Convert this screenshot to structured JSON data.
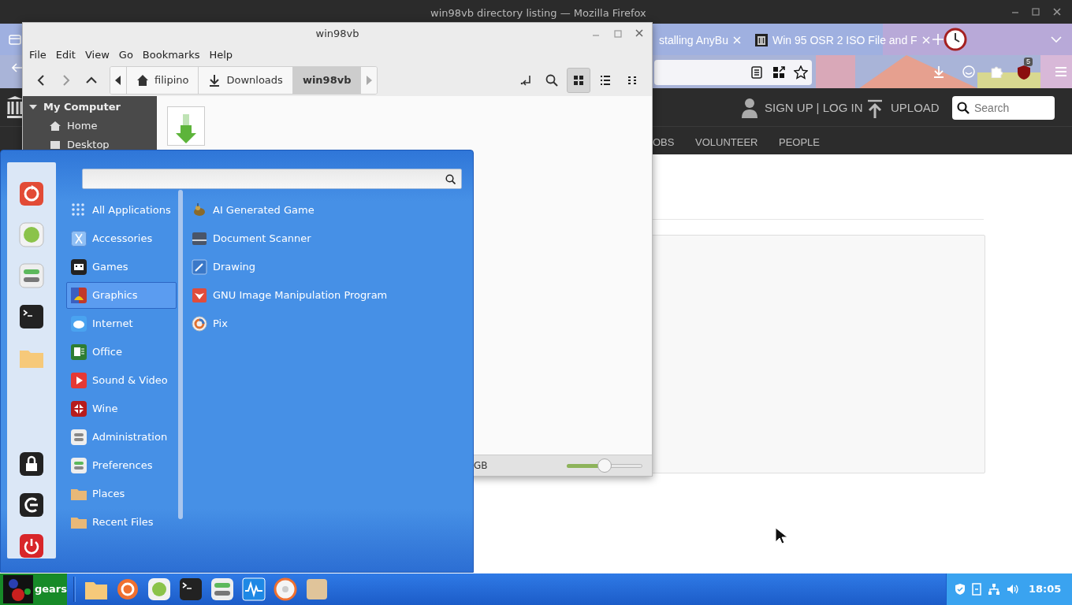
{
  "firefox": {
    "title": "win98vb directory listing — Mozilla Firefox",
    "tabs": [
      {
        "label": "stalling AnyBu",
        "selected": false
      },
      {
        "label": "Win 95 OSR 2 ISO File and F",
        "selected": false
      }
    ],
    "extension_badge": "5",
    "site": {
      "account": "SIGN UP | LOG IN",
      "upload": "UPLOAD",
      "search": {
        "placeholder": "Search"
      },
      "nav": [
        "OBS",
        "VOLUNTEER",
        "PEOPLE"
      ]
    }
  },
  "file_manager": {
    "title": "win98vb",
    "menu": [
      "File",
      "Edit",
      "View",
      "Go",
      "Bookmarks",
      "Help"
    ],
    "breadcrumbs": [
      {
        "label": "filipino",
        "kind": "home",
        "selected": false
      },
      {
        "label": "Downloads",
        "kind": "downloads",
        "selected": false
      },
      {
        "label": "win98vb",
        "kind": "folder",
        "selected": true
      }
    ],
    "views": [
      {
        "kind": "icons",
        "selected": true
      },
      {
        "kind": "list",
        "selected": false
      },
      {
        "kind": "compact",
        "selected": false
      }
    ],
    "sidebar": {
      "heading": "My Computer",
      "expanded": true,
      "items": [
        {
          "label": "Home",
          "kind": "home"
        },
        {
          "label": "Desktop",
          "kind": "desktop"
        }
      ]
    },
    "status": "GB",
    "zoom": {
      "level": 0.5
    }
  },
  "menu": {
    "categories": [
      {
        "label": "All Applications",
        "selected": false
      },
      {
        "label": "Accessories",
        "selected": false
      },
      {
        "label": "Games",
        "selected": false
      },
      {
        "label": "Graphics",
        "selected": true
      },
      {
        "label": "Internet",
        "selected": false
      },
      {
        "label": "Office",
        "selected": false
      },
      {
        "label": "Sound & Video",
        "selected": false
      },
      {
        "label": "Wine",
        "selected": false
      },
      {
        "label": "Administration",
        "selected": false
      },
      {
        "label": "Preferences",
        "selected": false
      },
      {
        "label": "Places",
        "selected": false
      },
      {
        "label": "Recent Files",
        "selected": false
      }
    ],
    "apps": [
      "AI Generated Game",
      "Document Scanner",
      "Drawing",
      "GNU Image Manipulation Program",
      "Pix"
    ]
  },
  "taskbar": {
    "start_label": "gears",
    "clock": "18:05"
  }
}
